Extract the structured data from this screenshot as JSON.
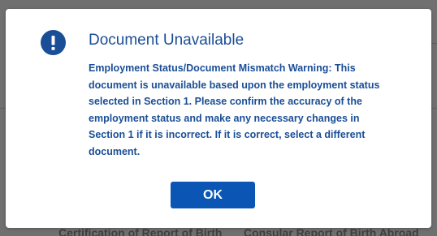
{
  "background": {
    "left_text": "Certification of Report of Birth",
    "right_text": "Consular Report of Birth Abroad"
  },
  "dialog": {
    "icon": "exclamation-circle-icon",
    "title": "Document Unavailable",
    "message_lines": [
      "Employment Status/Document Mismatch Warning: This",
      "document is unavailable based upon the employment status",
      "selected in Section 1. Please confirm the accuracy of the",
      "employment status and make any necessary changes in",
      "Section 1 if it is incorrect. If it is correct, select a different",
      "document."
    ],
    "ok_label": "OK"
  },
  "colors": {
    "accent": "#1a4e96",
    "button": "#0b56b5",
    "overlay": "#707070"
  }
}
